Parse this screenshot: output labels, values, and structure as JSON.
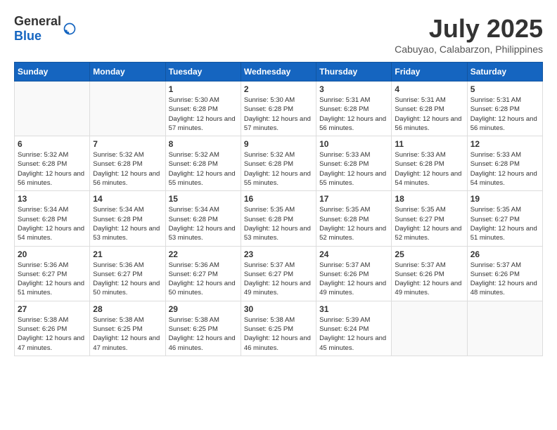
{
  "header": {
    "logo_general": "General",
    "logo_blue": "Blue",
    "month_year": "July 2025",
    "location": "Cabuyao, Calabarzon, Philippines"
  },
  "weekdays": [
    "Sunday",
    "Monday",
    "Tuesday",
    "Wednesday",
    "Thursday",
    "Friday",
    "Saturday"
  ],
  "weeks": [
    [
      {
        "day": "",
        "info": ""
      },
      {
        "day": "",
        "info": ""
      },
      {
        "day": "1",
        "info": "Sunrise: 5:30 AM\nSunset: 6:28 PM\nDaylight: 12 hours and 57 minutes."
      },
      {
        "day": "2",
        "info": "Sunrise: 5:30 AM\nSunset: 6:28 PM\nDaylight: 12 hours and 57 minutes."
      },
      {
        "day": "3",
        "info": "Sunrise: 5:31 AM\nSunset: 6:28 PM\nDaylight: 12 hours and 56 minutes."
      },
      {
        "day": "4",
        "info": "Sunrise: 5:31 AM\nSunset: 6:28 PM\nDaylight: 12 hours and 56 minutes."
      },
      {
        "day": "5",
        "info": "Sunrise: 5:31 AM\nSunset: 6:28 PM\nDaylight: 12 hours and 56 minutes."
      }
    ],
    [
      {
        "day": "6",
        "info": "Sunrise: 5:32 AM\nSunset: 6:28 PM\nDaylight: 12 hours and 56 minutes."
      },
      {
        "day": "7",
        "info": "Sunrise: 5:32 AM\nSunset: 6:28 PM\nDaylight: 12 hours and 56 minutes."
      },
      {
        "day": "8",
        "info": "Sunrise: 5:32 AM\nSunset: 6:28 PM\nDaylight: 12 hours and 55 minutes."
      },
      {
        "day": "9",
        "info": "Sunrise: 5:32 AM\nSunset: 6:28 PM\nDaylight: 12 hours and 55 minutes."
      },
      {
        "day": "10",
        "info": "Sunrise: 5:33 AM\nSunset: 6:28 PM\nDaylight: 12 hours and 55 minutes."
      },
      {
        "day": "11",
        "info": "Sunrise: 5:33 AM\nSunset: 6:28 PM\nDaylight: 12 hours and 54 minutes."
      },
      {
        "day": "12",
        "info": "Sunrise: 5:33 AM\nSunset: 6:28 PM\nDaylight: 12 hours and 54 minutes."
      }
    ],
    [
      {
        "day": "13",
        "info": "Sunrise: 5:34 AM\nSunset: 6:28 PM\nDaylight: 12 hours and 54 minutes."
      },
      {
        "day": "14",
        "info": "Sunrise: 5:34 AM\nSunset: 6:28 PM\nDaylight: 12 hours and 53 minutes."
      },
      {
        "day": "15",
        "info": "Sunrise: 5:34 AM\nSunset: 6:28 PM\nDaylight: 12 hours and 53 minutes."
      },
      {
        "day": "16",
        "info": "Sunrise: 5:35 AM\nSunset: 6:28 PM\nDaylight: 12 hours and 53 minutes."
      },
      {
        "day": "17",
        "info": "Sunrise: 5:35 AM\nSunset: 6:28 PM\nDaylight: 12 hours and 52 minutes."
      },
      {
        "day": "18",
        "info": "Sunrise: 5:35 AM\nSunset: 6:27 PM\nDaylight: 12 hours and 52 minutes."
      },
      {
        "day": "19",
        "info": "Sunrise: 5:35 AM\nSunset: 6:27 PM\nDaylight: 12 hours and 51 minutes."
      }
    ],
    [
      {
        "day": "20",
        "info": "Sunrise: 5:36 AM\nSunset: 6:27 PM\nDaylight: 12 hours and 51 minutes."
      },
      {
        "day": "21",
        "info": "Sunrise: 5:36 AM\nSunset: 6:27 PM\nDaylight: 12 hours and 50 minutes."
      },
      {
        "day": "22",
        "info": "Sunrise: 5:36 AM\nSunset: 6:27 PM\nDaylight: 12 hours and 50 minutes."
      },
      {
        "day": "23",
        "info": "Sunrise: 5:37 AM\nSunset: 6:27 PM\nDaylight: 12 hours and 49 minutes."
      },
      {
        "day": "24",
        "info": "Sunrise: 5:37 AM\nSunset: 6:26 PM\nDaylight: 12 hours and 49 minutes."
      },
      {
        "day": "25",
        "info": "Sunrise: 5:37 AM\nSunset: 6:26 PM\nDaylight: 12 hours and 49 minutes."
      },
      {
        "day": "26",
        "info": "Sunrise: 5:37 AM\nSunset: 6:26 PM\nDaylight: 12 hours and 48 minutes."
      }
    ],
    [
      {
        "day": "27",
        "info": "Sunrise: 5:38 AM\nSunset: 6:26 PM\nDaylight: 12 hours and 47 minutes."
      },
      {
        "day": "28",
        "info": "Sunrise: 5:38 AM\nSunset: 6:25 PM\nDaylight: 12 hours and 47 minutes."
      },
      {
        "day": "29",
        "info": "Sunrise: 5:38 AM\nSunset: 6:25 PM\nDaylight: 12 hours and 46 minutes."
      },
      {
        "day": "30",
        "info": "Sunrise: 5:38 AM\nSunset: 6:25 PM\nDaylight: 12 hours and 46 minutes."
      },
      {
        "day": "31",
        "info": "Sunrise: 5:39 AM\nSunset: 6:24 PM\nDaylight: 12 hours and 45 minutes."
      },
      {
        "day": "",
        "info": ""
      },
      {
        "day": "",
        "info": ""
      }
    ]
  ]
}
